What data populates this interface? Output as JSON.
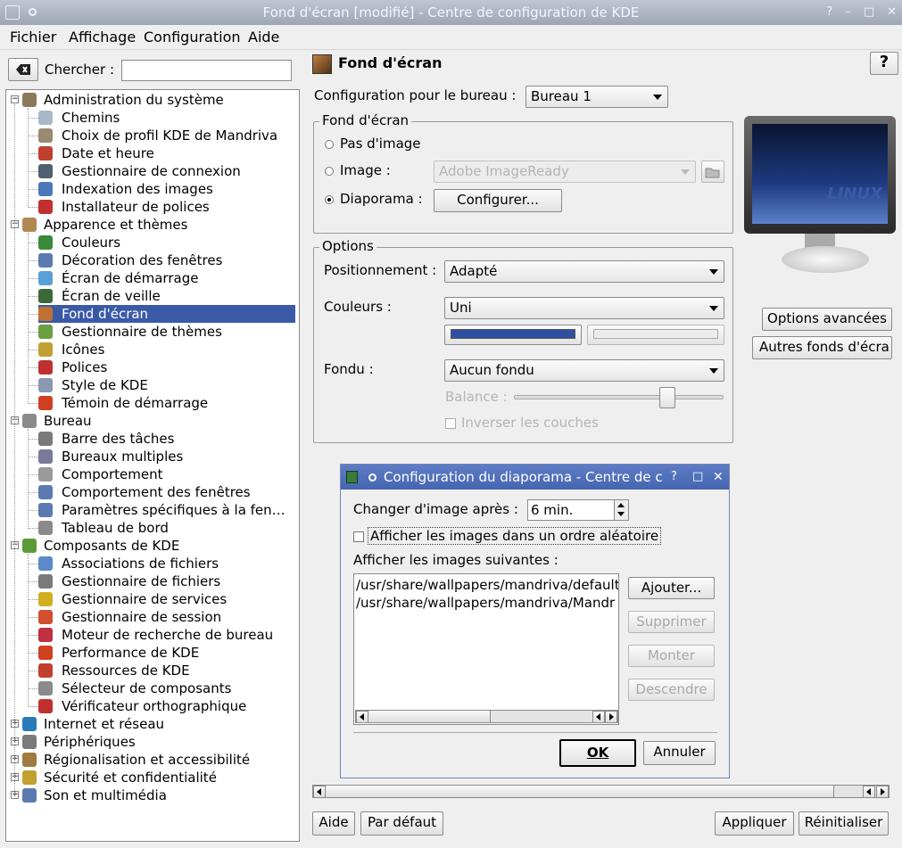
{
  "window": {
    "title": "Fond d'écran [modifié] - Centre de configuration de KDE",
    "buttons": [
      "?",
      "–",
      "□",
      "✕"
    ]
  },
  "menu": [
    "Fichier",
    "Affichage",
    "Configuration",
    "Aide"
  ],
  "search": {
    "label": "Chercher :",
    "value": ""
  },
  "tree": [
    {
      "label": "Administration du système",
      "level": 0,
      "icon": "admin-icon",
      "color": "#8a7a5a"
    },
    {
      "label": "Chemins",
      "level": 1,
      "icon": "paths-icon",
      "color": "#a8b8c8"
    },
    {
      "label": "Choix de profil KDE de Mandriva",
      "level": 1,
      "icon": "profile-icon",
      "color": "#9a8a70"
    },
    {
      "label": "Date et heure",
      "level": 1,
      "icon": "clock-icon",
      "color": "#c04030"
    },
    {
      "label": "Gestionnaire de connexion",
      "level": 1,
      "icon": "login-icon",
      "color": "#506070"
    },
    {
      "label": "Indexation des images",
      "level": 1,
      "icon": "image-index-icon",
      "color": "#4a78b8"
    },
    {
      "label": "Installateur de polices",
      "level": 1,
      "icon": "font-install-icon",
      "color": "#c03030"
    },
    {
      "label": "Apparence et thèmes",
      "level": 0,
      "icon": "appearance-icon",
      "color": "#b08850"
    },
    {
      "label": "Couleurs",
      "level": 1,
      "icon": "colors-icon",
      "color": "#3a8a3a"
    },
    {
      "label": "Décoration des fenêtres",
      "level": 1,
      "icon": "window-deco-icon",
      "color": "#5a7ab0"
    },
    {
      "label": "Écran de démarrage",
      "level": 1,
      "icon": "splash-icon",
      "color": "#5aa0d8"
    },
    {
      "label": "Écran de veille",
      "level": 1,
      "icon": "screensaver-icon",
      "color": "#3a6a3a"
    },
    {
      "label": "Fond d'écran",
      "level": 1,
      "icon": "wallpaper-icon",
      "color": "#c07030",
      "selected": true
    },
    {
      "label": "Gestionnaire de thèmes",
      "level": 1,
      "icon": "theme-icon",
      "color": "#6aa040"
    },
    {
      "label": "Icônes",
      "level": 1,
      "icon": "icons-icon",
      "color": "#c0a030"
    },
    {
      "label": "Polices",
      "level": 1,
      "icon": "fonts-icon",
      "color": "#c03030"
    },
    {
      "label": "Style de KDE",
      "level": 1,
      "icon": "style-icon",
      "color": "#8a98b0"
    },
    {
      "label": "Témoin de démarrage",
      "level": 1,
      "icon": "launch-icon",
      "color": "#d04020"
    },
    {
      "label": "Bureau",
      "level": 0,
      "icon": "desktop-icon",
      "color": "#8a8a8a"
    },
    {
      "label": "Barre des tâches",
      "level": 1,
      "icon": "taskbar-icon",
      "color": "#7a7a7a"
    },
    {
      "label": "Bureaux multiples",
      "level": 1,
      "icon": "multi-desktop-icon",
      "color": "#7a7a9a"
    },
    {
      "label": "Comportement",
      "level": 1,
      "icon": "behavior-icon",
      "color": "#9a9a9a"
    },
    {
      "label": "Comportement des fenêtres",
      "level": 1,
      "icon": "window-behavior-icon",
      "color": "#5a7ab0"
    },
    {
      "label": "Paramètres spécifiques à la fen…",
      "level": 1,
      "icon": "window-specific-icon",
      "color": "#5a7ab0"
    },
    {
      "label": "Tableau de bord",
      "level": 1,
      "icon": "panel-icon",
      "color": "#8a8a8a"
    },
    {
      "label": "Composants de KDE",
      "level": 0,
      "icon": "components-icon",
      "color": "#5a9a3a"
    },
    {
      "label": "Associations de fichiers",
      "level": 1,
      "icon": "file-assoc-icon",
      "color": "#5a8ac8"
    },
    {
      "label": "Gestionnaire de fichiers",
      "level": 1,
      "icon": "file-manager-icon",
      "color": "#7a7a7a"
    },
    {
      "label": "Gestionnaire de services",
      "level": 1,
      "icon": "services-icon",
      "color": "#d0b020"
    },
    {
      "label": "Gestionnaire de session",
      "level": 1,
      "icon": "session-icon",
      "color": "#d05030"
    },
    {
      "label": "Moteur de recherche de bureau",
      "level": 1,
      "icon": "search-engine-icon",
      "color": "#c03040"
    },
    {
      "label": "Performance de KDE",
      "level": 1,
      "icon": "performance-icon",
      "color": "#d04020"
    },
    {
      "label": "Ressources de KDE",
      "level": 1,
      "icon": "resources-icon",
      "color": "#c04030"
    },
    {
      "label": "Sélecteur de composants",
      "level": 1,
      "icon": "component-chooser-icon",
      "color": "#8a8a8a"
    },
    {
      "label": "Vérificateur orthographique",
      "level": 1,
      "icon": "spellcheck-icon",
      "color": "#c03030"
    },
    {
      "label": "Internet et réseau",
      "level": 0,
      "icon": "globe-icon",
      "color": "#2a7ab8"
    },
    {
      "label": "Périphériques",
      "level": 0,
      "icon": "peripherals-icon",
      "color": "#7a7a7a"
    },
    {
      "label": "Régionalisation et accessibilité",
      "level": 0,
      "icon": "region-icon",
      "color": "#a07a40"
    },
    {
      "label": "Sécurité et confidentialité",
      "level": 0,
      "icon": "key-icon",
      "color": "#c0a030"
    },
    {
      "label": "Son et multimédia",
      "level": 0,
      "icon": "speaker-icon",
      "color": "#5a7ab0"
    }
  ],
  "panel": {
    "title": "Fond d'écran",
    "help": "?",
    "config_label": "Configuration pour le bureau :",
    "config_value": "Bureau 1",
    "wallpaper_group": "Fond d'écran",
    "radio_none": "Pas d'image",
    "radio_image": "Image :",
    "image_value": "Adobe ImageReady",
    "radio_slideshow": "Diaporama :",
    "configure_btn": "Configurer...",
    "options_group": "Options",
    "position_label": "Positionnement :",
    "position_value": "Adapté",
    "colors_label": "Couleurs :",
    "colors_value": "Uni",
    "color1": "#2d4fa0",
    "color2": "#ececec",
    "blend_label": "Fondu :",
    "blend_value": "Aucun fondu",
    "balance_label": "Balance :",
    "invert_label": "Inverser les couches",
    "advanced_btn": "Options avancées",
    "other_btn": "Autres fonds d'écra",
    "monitor_text": "LINUX"
  },
  "dialog": {
    "title": "Configuration du diaporama - Centre de c",
    "buttons": [
      "?",
      "□",
      "✕"
    ],
    "change_label": "Changer d'image après :",
    "change_value": "6 min.",
    "random_label": "Afficher les images dans un ordre aléatoire",
    "list_label": "Afficher les images suivantes :",
    "files": [
      "/usr/share/wallpapers/mandriva/default",
      "/usr/share/wallpapers/mandriva/Mandr"
    ],
    "add_btn": "Ajouter...",
    "remove_btn": "Supprimer",
    "up_btn": "Monter",
    "down_btn": "Descendre",
    "ok_btn": "OK",
    "cancel_btn": "Annuler"
  },
  "footer": {
    "help": "Aide",
    "defaults": "Par défaut",
    "apply": "Appliquer",
    "reset": "Réinitialiser"
  }
}
